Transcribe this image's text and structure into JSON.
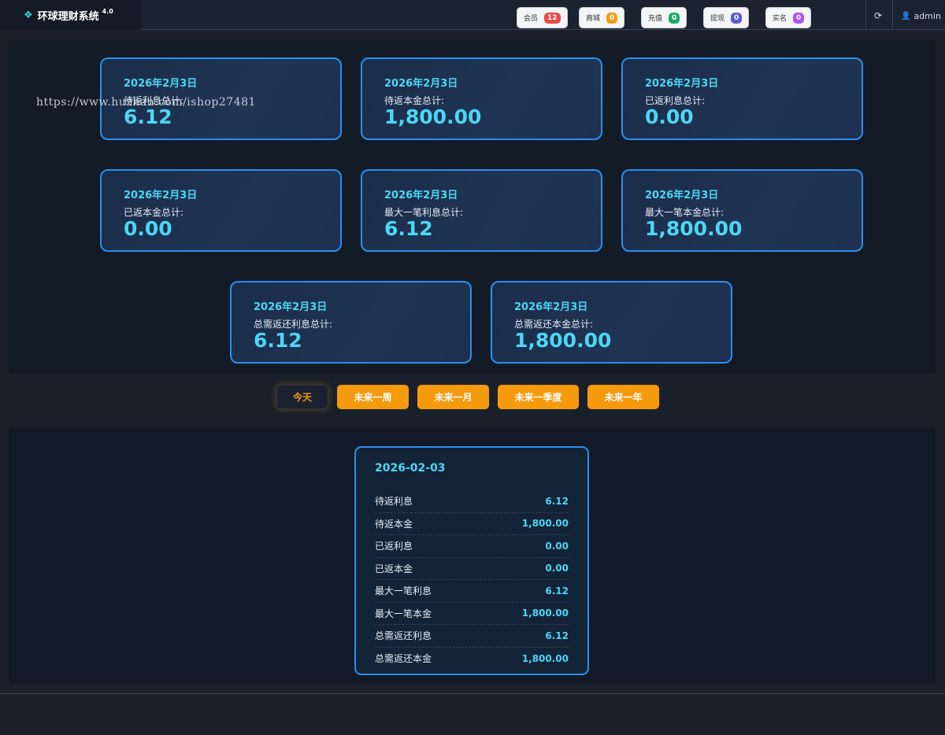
{
  "header": {
    "brand_icon": "diamond-grid-icon",
    "title": "环球理财系统",
    "version": "4.0",
    "chips": [
      {
        "label": "会员",
        "count": "12",
        "color": "#e84a4a"
      },
      {
        "label": "商城",
        "count": "0",
        "color": "#f39c12"
      },
      {
        "label": "充值",
        "count": "0",
        "color": "#1aaa6a"
      },
      {
        "label": "提现",
        "count": "0",
        "color": "#5b5bd6"
      },
      {
        "label": "实名",
        "count": "0",
        "color": "#a855f7"
      }
    ],
    "refresh_icon": "refresh-icon",
    "user_icon": "user-icon",
    "username": "admin"
  },
  "watermark": "https://www.huzhan.com/ishop27481",
  "cards": [
    {
      "date": "2026年2月3日",
      "label": "待返利息总计:",
      "value": "6.12"
    },
    {
      "date": "2026年2月3日",
      "label": "待返本金总计:",
      "value": "1,800.00"
    },
    {
      "date": "2026年2月3日",
      "label": "已返利息总计:",
      "value": "0.00"
    },
    {
      "date": "2026年2月3日",
      "label": "已返本金总计:",
      "value": "0.00"
    },
    {
      "date": "2026年2月3日",
      "label": "最大一笔利息总计:",
      "value": "6.12"
    },
    {
      "date": "2026年2月3日",
      "label": "最大一笔本金总计:",
      "value": "1,800.00"
    },
    {
      "date": "2026年2月3日",
      "label": "总需返还利息总计:",
      "value": "6.12"
    },
    {
      "date": "2026年2月3日",
      "label": "总需返还本金总计:",
      "value": "1,800.00"
    }
  ],
  "filters": [
    {
      "label": "今天",
      "active": true
    },
    {
      "label": "未来一周",
      "active": false
    },
    {
      "label": "未来一月",
      "active": false
    },
    {
      "label": "未来一季度",
      "active": false
    },
    {
      "label": "未来一年",
      "active": false
    }
  ],
  "detail": {
    "date": "2026-02-03",
    "rows": [
      {
        "label": "待返利息",
        "value": "6.12"
      },
      {
        "label": "待返本金",
        "value": "1,800.00"
      },
      {
        "label": "已返利息",
        "value": "0.00"
      },
      {
        "label": "已返本金",
        "value": "0.00"
      },
      {
        "label": "最大一笔利息",
        "value": "6.12"
      },
      {
        "label": "最大一笔本金",
        "value": "1,800.00"
      },
      {
        "label": "总需返还利息",
        "value": "6.12"
      },
      {
        "label": "总需返还本金",
        "value": "1,800.00"
      }
    ]
  }
}
